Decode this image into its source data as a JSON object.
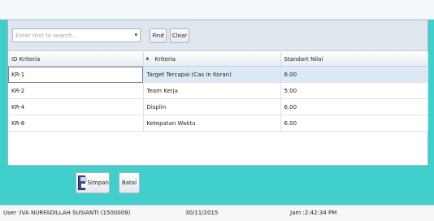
{
  "search": {
    "placeholder": "Enter text to search...",
    "find_label": "Find",
    "clear_label": "Clear"
  },
  "grid": {
    "columns": [
      "ID Kriteria",
      "Kriteria",
      "Standart Nilai"
    ],
    "rows": [
      [
        "KR-1",
        "Target Tercapai (Cas In Koran)",
        "6.00"
      ],
      [
        "KR-2",
        "Team Kerja",
        "5.00"
      ],
      [
        "KR-4",
        "Displin",
        "6.00"
      ],
      [
        "KR-8",
        "Ketepatan Waktu",
        "6.00"
      ]
    ]
  },
  "actions": {
    "save_label": "Simpan",
    "cancel_label": "Batal"
  },
  "status": {
    "user": "User :IVA NURFADILLAH SUSIANTI (1500009)",
    "date": "30/11/2015",
    "time": "Jam :2:42:34 PM"
  },
  "colors": {
    "frame": "#41cfcc",
    "selected_row": "#dde9f7"
  }
}
